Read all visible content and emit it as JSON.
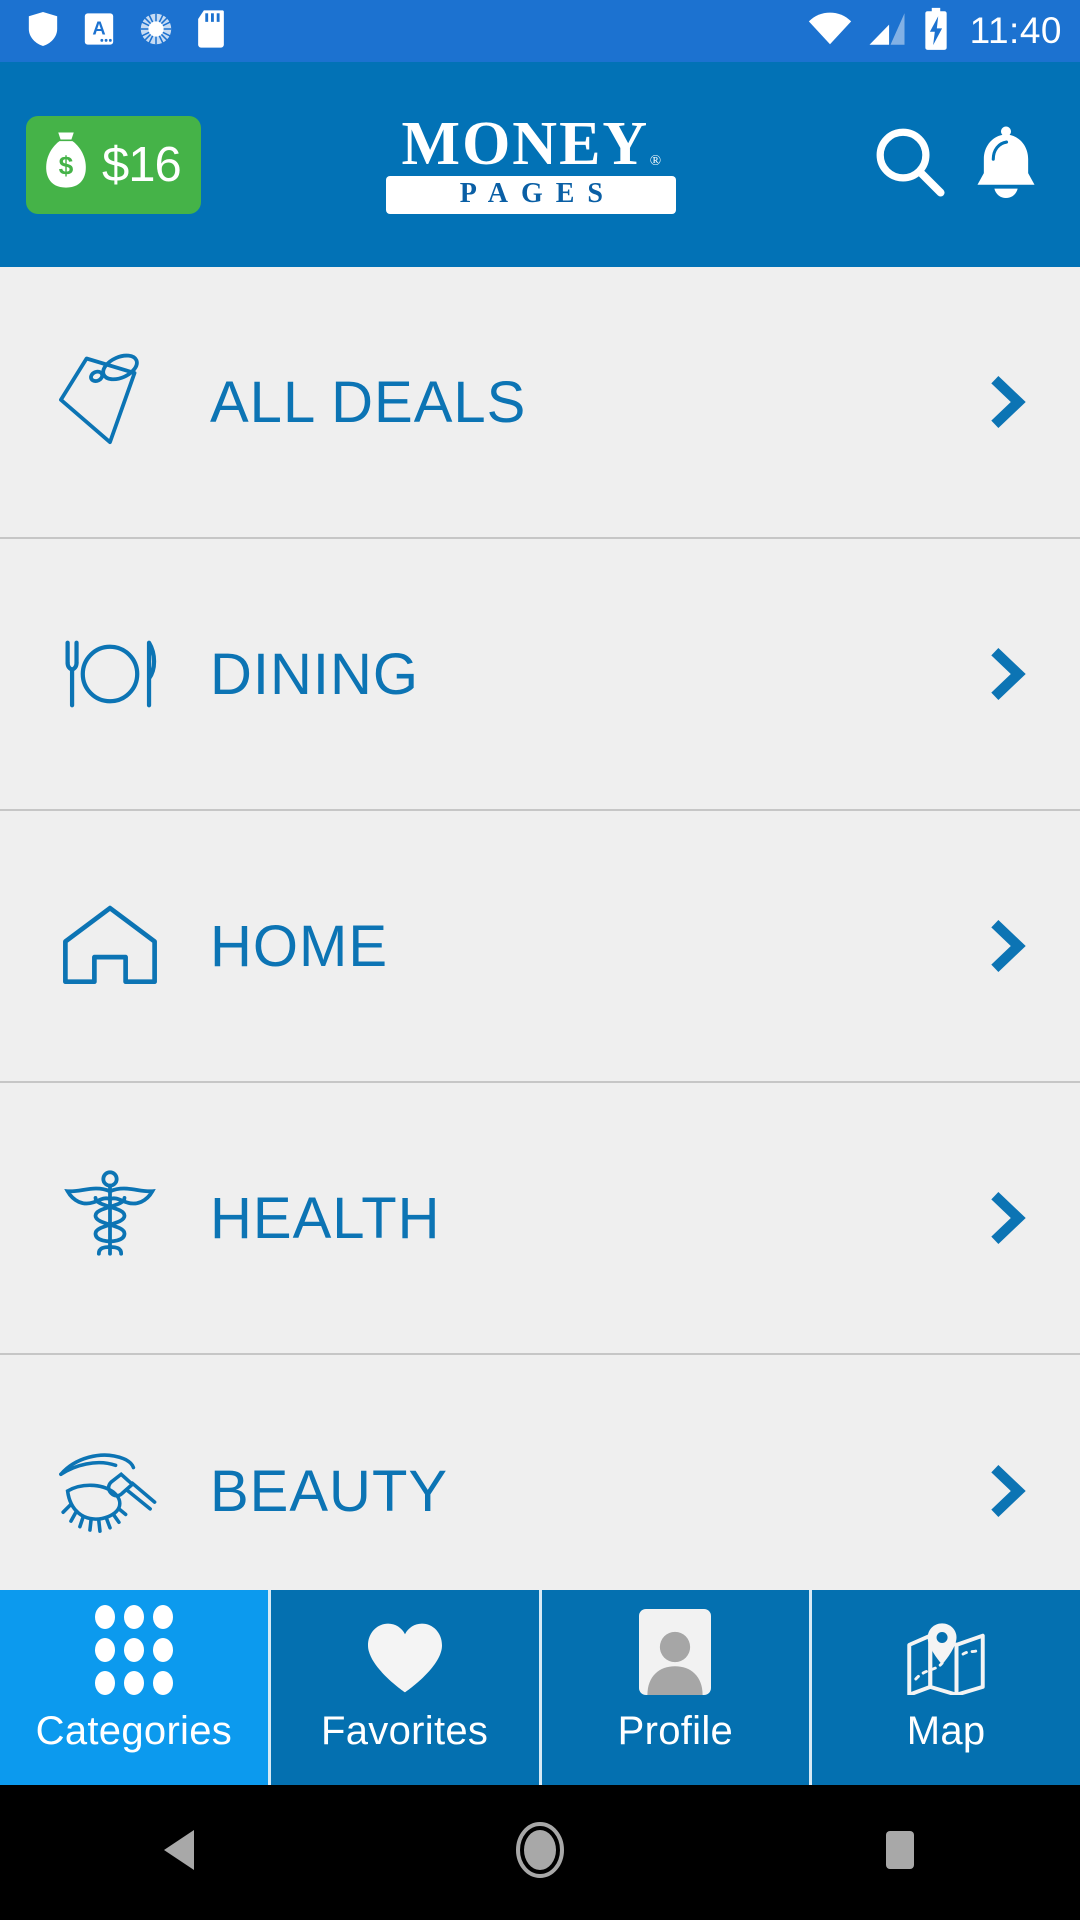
{
  "status_bar": {
    "time": "11:40",
    "left_icons": [
      "shield-icon",
      "keyboard-icon",
      "sync-icon",
      "sd-card-icon"
    ],
    "right_icons": [
      "wifi-icon",
      "cell-signal-icon",
      "battery-charging-icon"
    ],
    "background_color": "#1c72d0"
  },
  "header": {
    "cash_badge": {
      "amount": "$16",
      "icon": "money-bag-icon",
      "color": "#45b348"
    },
    "logo": {
      "primary": "MONEY",
      "secondary": "PAGES",
      "registered": "®"
    },
    "actions": [
      {
        "name": "search",
        "icon": "search-icon"
      },
      {
        "name": "notifications",
        "icon": "bell-icon"
      }
    ],
    "background_color": "#0272b6"
  },
  "categories": [
    {
      "label": "ALL DEALS",
      "icon": "price-tag-icon"
    },
    {
      "label": "DINING",
      "icon": "cutlery-plate-icon"
    },
    {
      "label": "HOME",
      "icon": "house-icon"
    },
    {
      "label": "HEALTH",
      "icon": "caduceus-icon"
    },
    {
      "label": "BEAUTY",
      "icon": "eye-makeup-icon"
    }
  ],
  "list_style": {
    "accent_color": "#0c74b4",
    "background_color": "#efefef",
    "divider_color": "#c6c6c6",
    "chevron_icon": "chevron-right-icon"
  },
  "bottom_nav": {
    "active_index": 0,
    "active_color": "#0c9aee",
    "inactive_color": "#0470b0",
    "tabs": [
      {
        "label": "Categories",
        "icon": "grid-dots-icon"
      },
      {
        "label": "Favorites",
        "icon": "heart-icon"
      },
      {
        "label": "Profile",
        "icon": "avatar-icon"
      },
      {
        "label": "Map",
        "icon": "map-pin-icon"
      }
    ]
  },
  "android_nav": {
    "buttons": [
      {
        "name": "back",
        "icon": "triangle-back-icon"
      },
      {
        "name": "home",
        "icon": "circle-home-icon"
      },
      {
        "name": "recents",
        "icon": "square-recents-icon"
      }
    ]
  }
}
